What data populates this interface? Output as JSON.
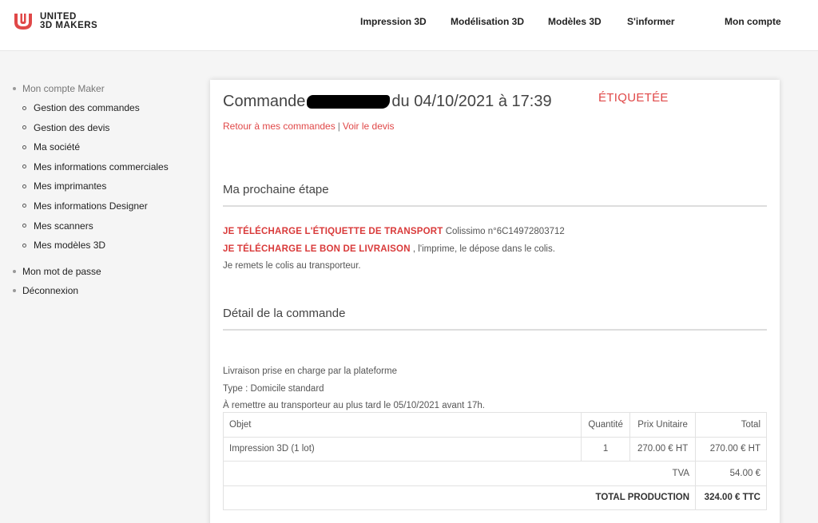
{
  "brand": {
    "line1": "UNITED",
    "line2": "3D MAKERS",
    "color": "#e04848"
  },
  "nav": {
    "items": [
      "Impression 3D",
      "Modélisation 3D",
      "Modèles 3D",
      "S'informer"
    ],
    "account": "Mon compte"
  },
  "sidebar": {
    "group": "Mon compte Maker",
    "items": [
      "Gestion des commandes",
      "Gestion des devis",
      "Ma société",
      "Mes informations commerciales",
      "Mes imprimantes",
      "Mes informations Designer",
      "Mes scanners",
      "Mes modèles 3D"
    ],
    "password": "Mon mot de passe",
    "logout": "Déconnexion"
  },
  "order": {
    "title_prefix": "Commande",
    "title_suffix": "du 04/10/2021 à 17:39",
    "status": "ÉTIQUETÉE",
    "back_link": "Retour à mes commandes",
    "separator": "|",
    "quote_link": "Voir le devis"
  },
  "next_step": {
    "title": "Ma prochaine étape",
    "label_download": "JE TÉLÉCHARGE L'ÉTIQUETTE DE TRANSPORT",
    "tracking": "Colissimo n°6C14972803712",
    "delivery_note": "JE TÉLÉCHARGE LE BON DE LIVRAISON",
    "delivery_note_text": ", l'imprime, le dépose dans le colis.",
    "handover": "Je remets le colis au transporteur."
  },
  "detail": {
    "title": "Détail de la commande",
    "shipping": "Livraison prise en charge par la plateforme",
    "type": "Type : Domicile standard",
    "deadline": "À remettre au transporteur au plus tard le 05/10/2021 avant 17h."
  },
  "table": {
    "headers": {
      "object": "Objet",
      "qty": "Quantité",
      "unit": "Prix Unitaire",
      "total": "Total"
    },
    "row": {
      "object": "Impression 3D (1 lot)",
      "qty": "1",
      "unit": "270.00 € HT",
      "total": "270.00 € HT"
    },
    "tva_label": "TVA",
    "tva_value": "54.00 €",
    "total_label": "TOTAL PRODUCTION",
    "total_value": "324.00 € TTC"
  }
}
